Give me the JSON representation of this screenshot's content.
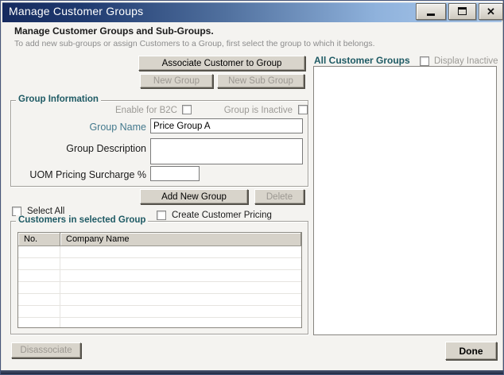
{
  "window": {
    "title": "Manage Customer Groups",
    "close_glyph": "✕"
  },
  "header": {
    "title": "Manage Customer Groups and Sub-Groups.",
    "subtitle": "To add new sub-groups or assign Customers to a Group, first select the group to which it belongs."
  },
  "toolbar": {
    "associate_label": "Associate Customer to Group",
    "new_group_label": "New Group",
    "new_sub_group_label": "New Sub Group"
  },
  "group_info": {
    "legend": "Group Information",
    "enable_b2c": {
      "label": "Enable for B2C",
      "checked": false,
      "enabled": false
    },
    "group_is_inactive": {
      "label": "Group is Inactive",
      "checked": false,
      "enabled": false
    },
    "group_name": {
      "label": "Group Name",
      "value": "Price Group A"
    },
    "group_description": {
      "label": "Group Description",
      "value": ""
    },
    "uom_surcharge": {
      "label": "UOM Pricing Surcharge %",
      "value": ""
    },
    "add_new_group_label": "Add New Group",
    "delete_label": "Delete"
  },
  "selection": {
    "select_all_label": "Select All",
    "select_all_checked": false,
    "create_customer_pricing_label": "Create Customer Pricing",
    "create_customer_pricing_checked": false
  },
  "customers_panel": {
    "legend": "Customers in selected Group",
    "columns": [
      "No.",
      "Company Name"
    ],
    "rows": []
  },
  "groups_panel": {
    "title": "All Customer Groups",
    "display_inactive_label": "Display Inactive",
    "display_inactive_checked": false,
    "items": []
  },
  "footer": {
    "disassociate_label": "Disassociate",
    "done_label": "Done"
  },
  "colors": {
    "titlebar_start": "#152A5E",
    "titlebar_end": "#AFCCEE",
    "legend_teal": "#1E5A64",
    "field_label_teal": "#44798D",
    "disabled_text": "#9C9892"
  }
}
